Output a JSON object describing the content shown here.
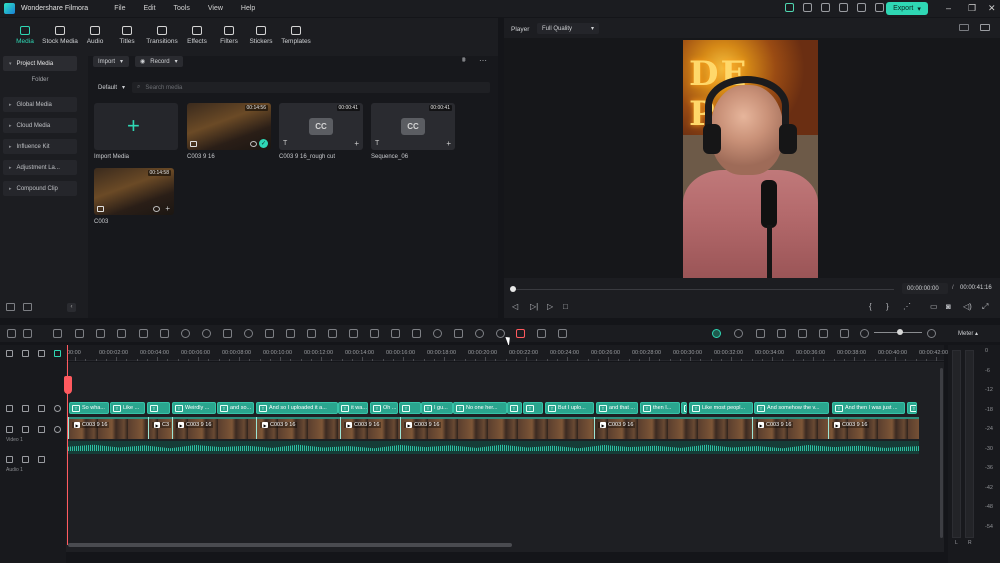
{
  "app": {
    "title": "Wondershare Filmora",
    "menu": [
      "File",
      "Edit",
      "Tools",
      "View",
      "Help"
    ],
    "export_label": "Export",
    "accent": "#2fd7b4"
  },
  "media_tabs": [
    {
      "label": "Media",
      "icon": "media-icon",
      "active": true
    },
    {
      "label": "Stock Media",
      "icon": "stock-media-icon"
    },
    {
      "label": "Audio",
      "icon": "music-note-icon"
    },
    {
      "label": "Titles",
      "icon": "text-t-icon"
    },
    {
      "label": "Transitions",
      "icon": "transition-icon"
    },
    {
      "label": "Effects",
      "icon": "effects-sparkle-icon"
    },
    {
      "label": "Filters",
      "icon": "filters-icon"
    },
    {
      "label": "Stickers",
      "icon": "sticker-icon"
    },
    {
      "label": "Templates",
      "icon": "templates-icon"
    }
  ],
  "sidebar": {
    "project_media": "Project Media",
    "folder": "Folder",
    "items": [
      "Global Media",
      "Cloud Media",
      "Influence Kit",
      "Adjustment La...",
      "Compound Clip"
    ]
  },
  "media_toolbar": {
    "import": "Import",
    "record": "Record",
    "sort": "Default",
    "search_placeholder": "Search media"
  },
  "media_items": [
    {
      "name": "Import Media",
      "type": "import"
    },
    {
      "name": "C003 9 16",
      "type": "video",
      "duration": "00:14:56"
    },
    {
      "name": "C003 9 16_rough cut",
      "type": "cc",
      "duration": "00:00:41"
    },
    {
      "name": "Sequence_06",
      "type": "cc",
      "duration": "00:00:41"
    },
    {
      "name": "C003",
      "type": "video",
      "duration": "00:14:58"
    }
  ],
  "player": {
    "label": "Player",
    "quality": "Full Quality",
    "sign_text": "DE POC",
    "current_time": "00:00:00:00",
    "separator": "/",
    "total_time": "00:00:41:16"
  },
  "timeline": {
    "meter_label": "Meter",
    "ruler": [
      "00:00",
      "00:00:02:00",
      "00:00:04:00",
      "00:00:06:00",
      "00:00:08:00",
      "00:00:10:00",
      "00:00:12:00",
      "00:00:14:00",
      "00:00:16:00",
      "00:00:18:00",
      "00:00:20:00",
      "00:00:22:00",
      "00:00:24:00",
      "00:00:26:00",
      "00:00:28:00",
      "00:00:30:00",
      "00:00:32:00",
      "00:00:34:00",
      "00:00:36:00",
      "00:00:38:00",
      "00:00:40:00",
      "00:00:42:00"
    ],
    "title_clips": [
      "So wha...",
      "Like ...",
      "",
      "Weirdly ...",
      "and so...",
      "And so I uploaded it a...",
      "it wa...",
      "Oh ...",
      "",
      "I gu...",
      "No one her...",
      "",
      "",
      "But I uplo...",
      "and that ...",
      "then I...",
      "",
      "Like most peopl...",
      "And somehow the v...",
      "And then I was just ...",
      ""
    ],
    "video_clips": [
      "C003 9 16",
      "C3",
      "C003 9 16",
      "C003 9 16",
      "C003 9 16",
      "C003 9 16",
      "C003 9 16",
      "C003 9 16",
      "C003 9 16"
    ],
    "track_labels": {
      "video": "Video 1",
      "audio": "Audio 1"
    }
  },
  "meter": {
    "db_marks": [
      "0",
      "-6",
      "-12",
      "-18",
      "-24",
      "-30",
      "-36",
      "-42",
      "-48",
      "-54"
    ],
    "left": "L",
    "right": "R"
  }
}
